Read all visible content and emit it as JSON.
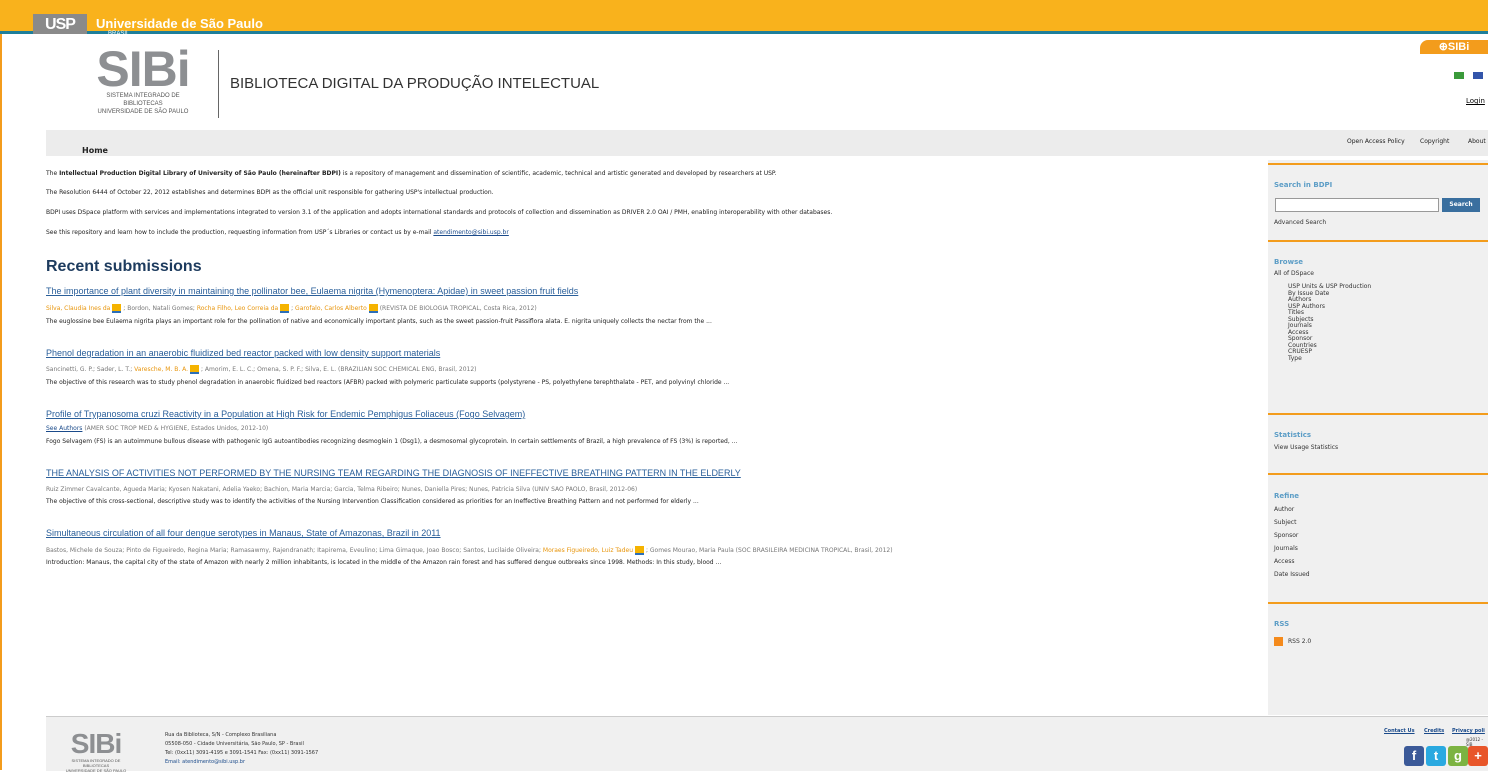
{
  "topbar": {
    "logo_text": "USP",
    "title": "Universidade de São Paulo",
    "subtitle": "BRASIL"
  },
  "header": {
    "sibi": "SIBi",
    "sibi_line1": "SISTEMA INTEGRADO DE BIBLIOTECAS",
    "sibi_line2": "UNIVERSIDADE DE SÃO PAULO",
    "title": "BIBLIOTECA DIGITAL DA PRODUÇÃO INTELECTUAL",
    "tab": "⊕SIBi",
    "login": "Login"
  },
  "nav": {
    "home": "Home",
    "open_access": "Open Access Policy",
    "copyright": "Copyright",
    "about": "About"
  },
  "intro": {
    "p1_bold": "Intellectual Production Digital Library of University of São Paulo (hereinafter BDPI)",
    "p1_pre": "The ",
    "p1_post": " is a repository of management and dissemination of scientific, academic, technical and artistic generated and developed by researchers at USP.",
    "p2": "The Resolution 6444 of October 22, 2012 establishes and determines BDPI as the official unit responsible for gathering USP's intellectual production.",
    "p3": "BDPI uses DSpace platform with services and implementations integrated to version 3.1 of the application and adopts international standards and protocols of collection and dissemination as DRIVER 2.0 OAI / PMH, enabling interoperability with other databases.",
    "p4": "See this repository and learn how to include the production, requesting information from USP´s Libraries or contact us by e-mail ",
    "email": "atendimento@sibi.usp.br"
  },
  "recent": {
    "heading": "Recent submissions",
    "items": [
      {
        "title": "The importance of plant diversity in maintaining the pollinator bee, Eulaema nigrita (Hymenoptera: Apidae) in sweet passion fruit fields",
        "authors_a": "Silva, Claudia Ines da",
        "authors_b": " ; Bordon, Natali Gomes; ",
        "authors_c": "Rocha Filho, Leo Correia da",
        "authors_d": " ; ",
        "authors_e": "Garofalo, Carlos Alberto",
        "source": " (REVISTA DE BIOLOGIA TROPICAL, Costa Rica, 2012)",
        "abstract": "The euglossine bee Eulaema nigrita plays an important role for the pollination of native and economically important plants, such as the sweet passion-fruit Passiflora alata. E. nigrita uniquely collects the nectar from the ..."
      },
      {
        "title": "Phenol degradation in an anaerobic fluidized bed reactor packed with low density support materials",
        "authors_a": "Sancinetti, G. P.; Sader, L. T.; ",
        "authors_b": "Varesche, M. B. A.",
        "authors_c": " ; Amorim, E. L. C.; Omena, S. P. F.; Silva, E. L. (BRAZILIAN SOC CHEMICAL ENG, Brasil, 2012)",
        "abstract": "The objective of this research was to study phenol degradation in anaerobic fluidized bed reactors (AFBR) packed with polymeric particulate supports (polystyrene - PS, polyethylene terephthalate - PET, and polyvinyl chloride ..."
      },
      {
        "title": "Profile of Trypanosoma cruzi Reactivity in a Population at High Risk for Endemic Pemphigus Foliaceus (Fogo Selvagem)",
        "see_authors": "See Authors",
        "source": " (AMER SOC TROP MED & HYGIENE, Estados Unidos, 2012-10)",
        "abstract": "Fogo Selvagem (FS) is an autoimmune bullous disease with pathogenic IgG autoantibodies recognizing desmoglein 1 (Dsg1), a desmosomal glycoprotein. In certain settlements of Brazil, a high prevalence of FS (3%) is reported, ..."
      },
      {
        "title": "THE ANALYSIS OF ACTIVITIES NOT PERFORMED BY THE NURSING TEAM REGARDING THE DIAGNOSIS OF INEFFECTIVE BREATHING PATTERN IN THE ELDERLY",
        "authors": "Ruiz Zimmer Cavalcante, Agueda Maria; Kyosen Nakatani, Adelia Yaeko; Bachion, Maria Marcia; Garcia, Telma Ribeiro; Nunes, Daniella Pires; Nunes, Patricia Silva (UNIV SAO PAOLO, Brasil, 2012-06)",
        "abstract": "The objective of this cross-sectional, descriptive study was to identify the activities of the Nursing Intervention Classification considered as priorities for an Ineffective Breathing Pattern and not performed for elderly ..."
      },
      {
        "title": "Simultaneous circulation of all four dengue serotypes in Manaus, State of Amazonas, Brazil in 2011",
        "authors_a": "Bastos, Michele de Souza; Pinto de Figueiredo, Regina Maria; Ramasawmy, Rajendranath; Itapirema, Eveulino; Lima Gimaque, Joao Bosco; Santos, Lucilaide Oliveira; ",
        "authors_b": "Moraes Figueiredo, Luiz Tadeu",
        "authors_c": " ; Gomes Mourao, Maria Paula (SOC BRASILEIRA MEDICINA TROPICAL, Brasil, 2012)",
        "abstract": "Introduction: Manaus, the capital city of the state of Amazon with nearly 2 million inhabitants, is located in the middle of the Amazon rain forest and has suffered dengue outbreaks since 1998. Methods: In this study, blood ..."
      }
    ]
  },
  "sidebar": {
    "search_head": "Search in BDPI",
    "search_btn": "Search",
    "advanced": "Advanced Search",
    "browse_head": "Browse",
    "all_dspace": "All of DSpace",
    "browse_items": [
      "USP Units & USP Production",
      "By Issue Date",
      "Authors",
      "USP Authors",
      "Titles",
      "Subjects",
      "Journals",
      "Access",
      "Sponsor",
      "Countries",
      "CRUESP",
      "Type"
    ],
    "stats_head": "Statistics",
    "stats_item": "View Usage Statistics",
    "refine_head": "Refine",
    "refine_items": [
      "Author",
      "Subject",
      "Sponsor",
      "Journals",
      "Access",
      "Date Issued"
    ],
    "rss_head": "RSS",
    "rss_item": "RSS 2.0"
  },
  "footer": {
    "sibi": "SIBi",
    "sibi_line1": "SISTEMA INTEGRADO DE BIBLIOTECAS",
    "sibi_line2": "UNIVERSIDADE DE SÃO PAULO",
    "addr1": "Rua da Biblioteca, S/N - Complexo Brasiliana",
    "addr2": "05508-050 - Cidade Universitária, São Paulo, SP - Brasil",
    "addr3": "Tel: (0xx11) 3091-4195 e 3091-1541 Fax: (0xx11) 3091-1567",
    "addr4": "Email: atendimento@sibi.usp.br",
    "contact": "Contact Us",
    "credits": "Credits",
    "privacy": "Privacy poli",
    "copy": "@2012 - SIB"
  },
  "colors": {
    "accent": "#f39c1c",
    "topbar": "#f9b21c",
    "link": "#2a5f9a"
  }
}
